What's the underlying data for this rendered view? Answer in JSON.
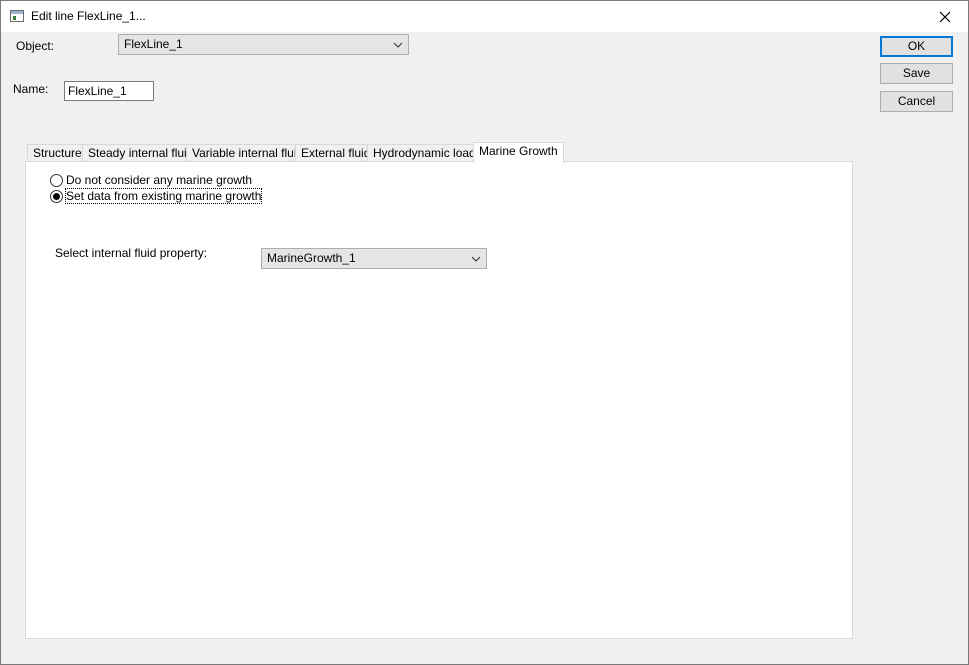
{
  "window": {
    "title": "Edit line FlexLine_1..."
  },
  "object": {
    "label": "Object:",
    "value": "FlexLine_1"
  },
  "name": {
    "label": "Name:",
    "value": "FlexLine_1"
  },
  "buttons": {
    "ok": "OK",
    "save": "Save",
    "cancel": "Cancel"
  },
  "tabs": [
    {
      "label": "Structure"
    },
    {
      "label": "Steady internal fluid"
    },
    {
      "label": "Variable internal fluid"
    },
    {
      "label": "External fluid"
    },
    {
      "label": "Hydrodynamic loads"
    },
    {
      "label": "Marine Growth",
      "active": true
    }
  ],
  "marine_growth": {
    "option_none": "Do not consider any marine growth",
    "option_existing": "Set data from existing marine growth",
    "selected_option": "option_existing",
    "select_label": "Select internal fluid property:",
    "select_value": "MarineGrowth_1"
  },
  "icons": {
    "app": "window-app-icon",
    "close": "close-icon",
    "dropdown": "chevron-down-icon"
  }
}
